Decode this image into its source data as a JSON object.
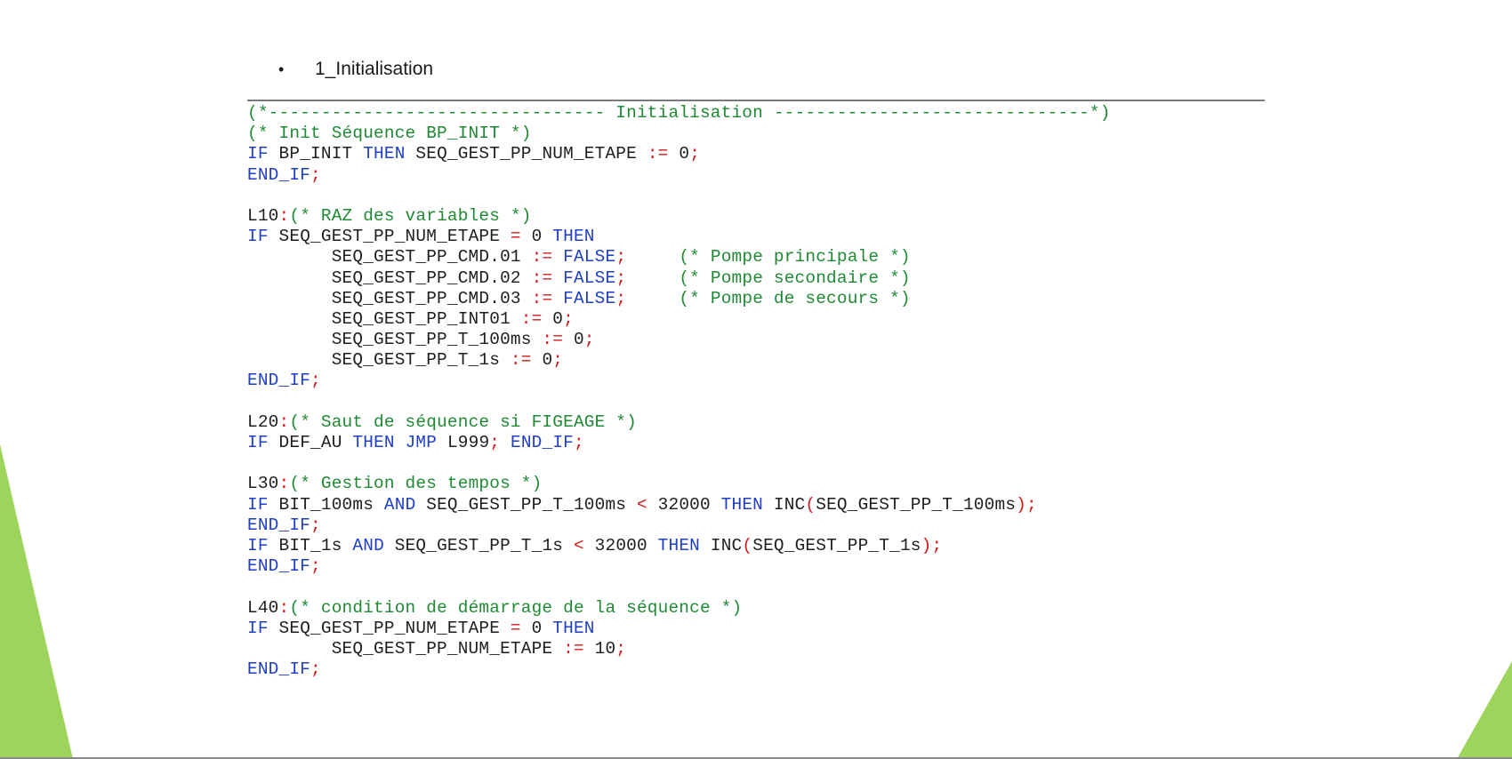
{
  "slide": {
    "bullet_marker": "•",
    "bullet_text": "1_Initialisation"
  },
  "colors": {
    "comment": "#1f8a34",
    "keyword": "#1f3fc9",
    "operator": "#d21a1a",
    "text": "#1e1e1e",
    "accent_green": "#9dd45b"
  },
  "code": {
    "lines": [
      [
        {
          "t": "(*-------------------------------- Initialisation ------------------------------*)",
          "s": "c"
        }
      ],
      [
        {
          "t": "(* Init Séquence BP_INIT *)",
          "s": "c"
        }
      ],
      [
        {
          "t": "IF",
          "s": "k"
        },
        {
          "t": " BP_INIT ",
          "s": "n"
        },
        {
          "t": "THEN",
          "s": "k"
        },
        {
          "t": " SEQ_GEST_PP_NUM_ETAPE ",
          "s": "n"
        },
        {
          "t": ":=",
          "s": "o"
        },
        {
          "t": " 0",
          "s": "n"
        },
        {
          "t": ";",
          "s": "o"
        }
      ],
      [
        {
          "t": "END_IF",
          "s": "k"
        },
        {
          "t": ";",
          "s": "o"
        }
      ],
      [],
      [
        {
          "t": "L10",
          "s": "n"
        },
        {
          "t": ":",
          "s": "o"
        },
        {
          "t": "(* RAZ des variables *)",
          "s": "c"
        }
      ],
      [
        {
          "t": "IF",
          "s": "k"
        },
        {
          "t": " SEQ_GEST_PP_NUM_ETAPE ",
          "s": "n"
        },
        {
          "t": "=",
          "s": "o"
        },
        {
          "t": " 0 ",
          "s": "n"
        },
        {
          "t": "THEN",
          "s": "k"
        }
      ],
      [
        {
          "t": "        SEQ_GEST_PP_CMD.01 ",
          "s": "n"
        },
        {
          "t": ":=",
          "s": "o"
        },
        {
          "t": " ",
          "s": "n"
        },
        {
          "t": "FALSE",
          "s": "k"
        },
        {
          "t": ";",
          "s": "o"
        },
        {
          "t": "     ",
          "s": "n"
        },
        {
          "t": "(* Pompe principale *)",
          "s": "c"
        }
      ],
      [
        {
          "t": "        SEQ_GEST_PP_CMD.02 ",
          "s": "n"
        },
        {
          "t": ":=",
          "s": "o"
        },
        {
          "t": " ",
          "s": "n"
        },
        {
          "t": "FALSE",
          "s": "k"
        },
        {
          "t": ";",
          "s": "o"
        },
        {
          "t": "     ",
          "s": "n"
        },
        {
          "t": "(* Pompe secondaire *)",
          "s": "c"
        }
      ],
      [
        {
          "t": "        SEQ_GEST_PP_CMD.03 ",
          "s": "n"
        },
        {
          "t": ":=",
          "s": "o"
        },
        {
          "t": " ",
          "s": "n"
        },
        {
          "t": "FALSE",
          "s": "k"
        },
        {
          "t": ";",
          "s": "o"
        },
        {
          "t": "     ",
          "s": "n"
        },
        {
          "t": "(* Pompe de secours *)",
          "s": "c"
        }
      ],
      [
        {
          "t": "        SEQ_GEST_PP_INT01 ",
          "s": "n"
        },
        {
          "t": ":=",
          "s": "o"
        },
        {
          "t": " 0",
          "s": "n"
        },
        {
          "t": ";",
          "s": "o"
        }
      ],
      [
        {
          "t": "        SEQ_GEST_PP_T_100ms ",
          "s": "n"
        },
        {
          "t": ":=",
          "s": "o"
        },
        {
          "t": " 0",
          "s": "n"
        },
        {
          "t": ";",
          "s": "o"
        }
      ],
      [
        {
          "t": "        SEQ_GEST_PP_T_1s ",
          "s": "n"
        },
        {
          "t": ":=",
          "s": "o"
        },
        {
          "t": " 0",
          "s": "n"
        },
        {
          "t": ";",
          "s": "o"
        }
      ],
      [
        {
          "t": "END_IF",
          "s": "k"
        },
        {
          "t": ";",
          "s": "o"
        }
      ],
      [],
      [
        {
          "t": "L20",
          "s": "n"
        },
        {
          "t": ":",
          "s": "o"
        },
        {
          "t": "(* Saut de séquence si FIGEAGE *)",
          "s": "c"
        }
      ],
      [
        {
          "t": "IF",
          "s": "k"
        },
        {
          "t": " DEF_AU ",
          "s": "n"
        },
        {
          "t": "THEN",
          "s": "k"
        },
        {
          "t": " ",
          "s": "n"
        },
        {
          "t": "JMP",
          "s": "k"
        },
        {
          "t": " L999",
          "s": "n"
        },
        {
          "t": ";",
          "s": "o"
        },
        {
          "t": " ",
          "s": "n"
        },
        {
          "t": "END_IF",
          "s": "k"
        },
        {
          "t": ";",
          "s": "o"
        }
      ],
      [],
      [
        {
          "t": "L30",
          "s": "n"
        },
        {
          "t": ":",
          "s": "o"
        },
        {
          "t": "(* Gestion des tempos *)",
          "s": "c"
        }
      ],
      [
        {
          "t": "IF",
          "s": "k"
        },
        {
          "t": " BIT_100ms ",
          "s": "n"
        },
        {
          "t": "AND",
          "s": "k"
        },
        {
          "t": " SEQ_GEST_PP_T_100ms ",
          "s": "n"
        },
        {
          "t": "<",
          "s": "o"
        },
        {
          "t": " 32000 ",
          "s": "n"
        },
        {
          "t": "THEN",
          "s": "k"
        },
        {
          "t": " INC",
          "s": "n"
        },
        {
          "t": "(",
          "s": "o"
        },
        {
          "t": "SEQ_GEST_PP_T_100ms",
          "s": "n"
        },
        {
          "t": ");",
          "s": "o"
        }
      ],
      [
        {
          "t": "END_IF",
          "s": "k"
        },
        {
          "t": ";",
          "s": "o"
        }
      ],
      [
        {
          "t": "IF",
          "s": "k"
        },
        {
          "t": " BIT_1s ",
          "s": "n"
        },
        {
          "t": "AND",
          "s": "k"
        },
        {
          "t": " SEQ_GEST_PP_T_1s ",
          "s": "n"
        },
        {
          "t": "<",
          "s": "o"
        },
        {
          "t": " 32000 ",
          "s": "n"
        },
        {
          "t": "THEN",
          "s": "k"
        },
        {
          "t": " INC",
          "s": "n"
        },
        {
          "t": "(",
          "s": "o"
        },
        {
          "t": "SEQ_GEST_PP_T_1s",
          "s": "n"
        },
        {
          "t": ");",
          "s": "o"
        }
      ],
      [
        {
          "t": "END_IF",
          "s": "k"
        },
        {
          "t": ";",
          "s": "o"
        }
      ],
      [],
      [
        {
          "t": "L40",
          "s": "n"
        },
        {
          "t": ":",
          "s": "o"
        },
        {
          "t": "(* condition de démarrage de la séquence *)",
          "s": "c"
        }
      ],
      [
        {
          "t": "IF",
          "s": "k"
        },
        {
          "t": " SEQ_GEST_PP_NUM_ETAPE ",
          "s": "n"
        },
        {
          "t": "=",
          "s": "o"
        },
        {
          "t": " 0 ",
          "s": "n"
        },
        {
          "t": "THEN",
          "s": "k"
        }
      ],
      [
        {
          "t": "        SEQ_GEST_PP_NUM_ETAPE ",
          "s": "n"
        },
        {
          "t": ":=",
          "s": "o"
        },
        {
          "t": " 10",
          "s": "n"
        },
        {
          "t": ";",
          "s": "o"
        }
      ],
      [
        {
          "t": "END_IF",
          "s": "k"
        },
        {
          "t": ";",
          "s": "o"
        }
      ]
    ]
  }
}
